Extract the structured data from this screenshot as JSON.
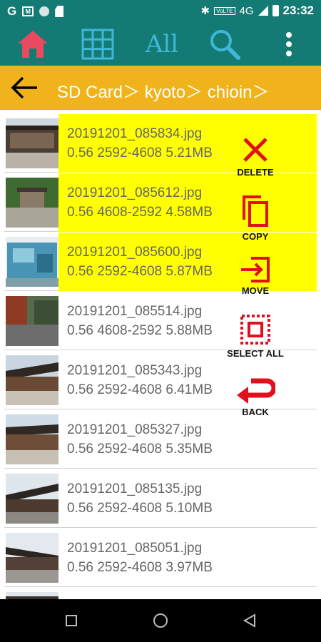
{
  "status_bar": {
    "time": "23:32",
    "g_icon": "G",
    "network": "4G",
    "volte": "VoLTE"
  },
  "toolbar": {
    "home_icon": "home-icon",
    "grid_icon": "grid-icon",
    "all_label": "All",
    "search_icon": "search-icon",
    "more_icon": "more-vert-icon",
    "accent_color": "#e84a5f",
    "icon_color": "#3fb8d8"
  },
  "breadcrumb": {
    "path": "SD Card＞ kyoto＞ chioin＞"
  },
  "files": [
    {
      "name": "20191201_085834.jpg",
      "meta": "0.56 2592-4608  5.21MB",
      "selected": true
    },
    {
      "name": "20191201_085612.jpg",
      "meta": "0.56 4608-2592  4.58MB",
      "selected": true
    },
    {
      "name": "20191201_085600.jpg",
      "meta": "0.56 2592-4608  5.87MB",
      "selected": true
    },
    {
      "name": "20191201_085514.jpg",
      "meta": "0.56 4608-2592  5.88MB",
      "selected": false
    },
    {
      "name": "20191201_085343.jpg",
      "meta": "0.56 2592-4608  6.41MB",
      "selected": false
    },
    {
      "name": "20191201_085327.jpg",
      "meta": "0.56 2592-4608  5.35MB",
      "selected": false
    },
    {
      "name": "20191201_085135.jpg",
      "meta": "0.56 2592-4608  5.10MB",
      "selected": false
    },
    {
      "name": "20191201_085051.jpg",
      "meta": "0.56 2592-4608  3.97MB",
      "selected": false
    }
  ],
  "actions": {
    "delete": "DELETE",
    "copy": "COPY",
    "move": "MOVE",
    "select_all": "SELECT ALL",
    "back": "BACK",
    "color": "#e0101e"
  },
  "colors": {
    "primary": "#137a74",
    "breadcrumb_bg": "#f0b31c",
    "selected_bg": "#ffff00"
  }
}
